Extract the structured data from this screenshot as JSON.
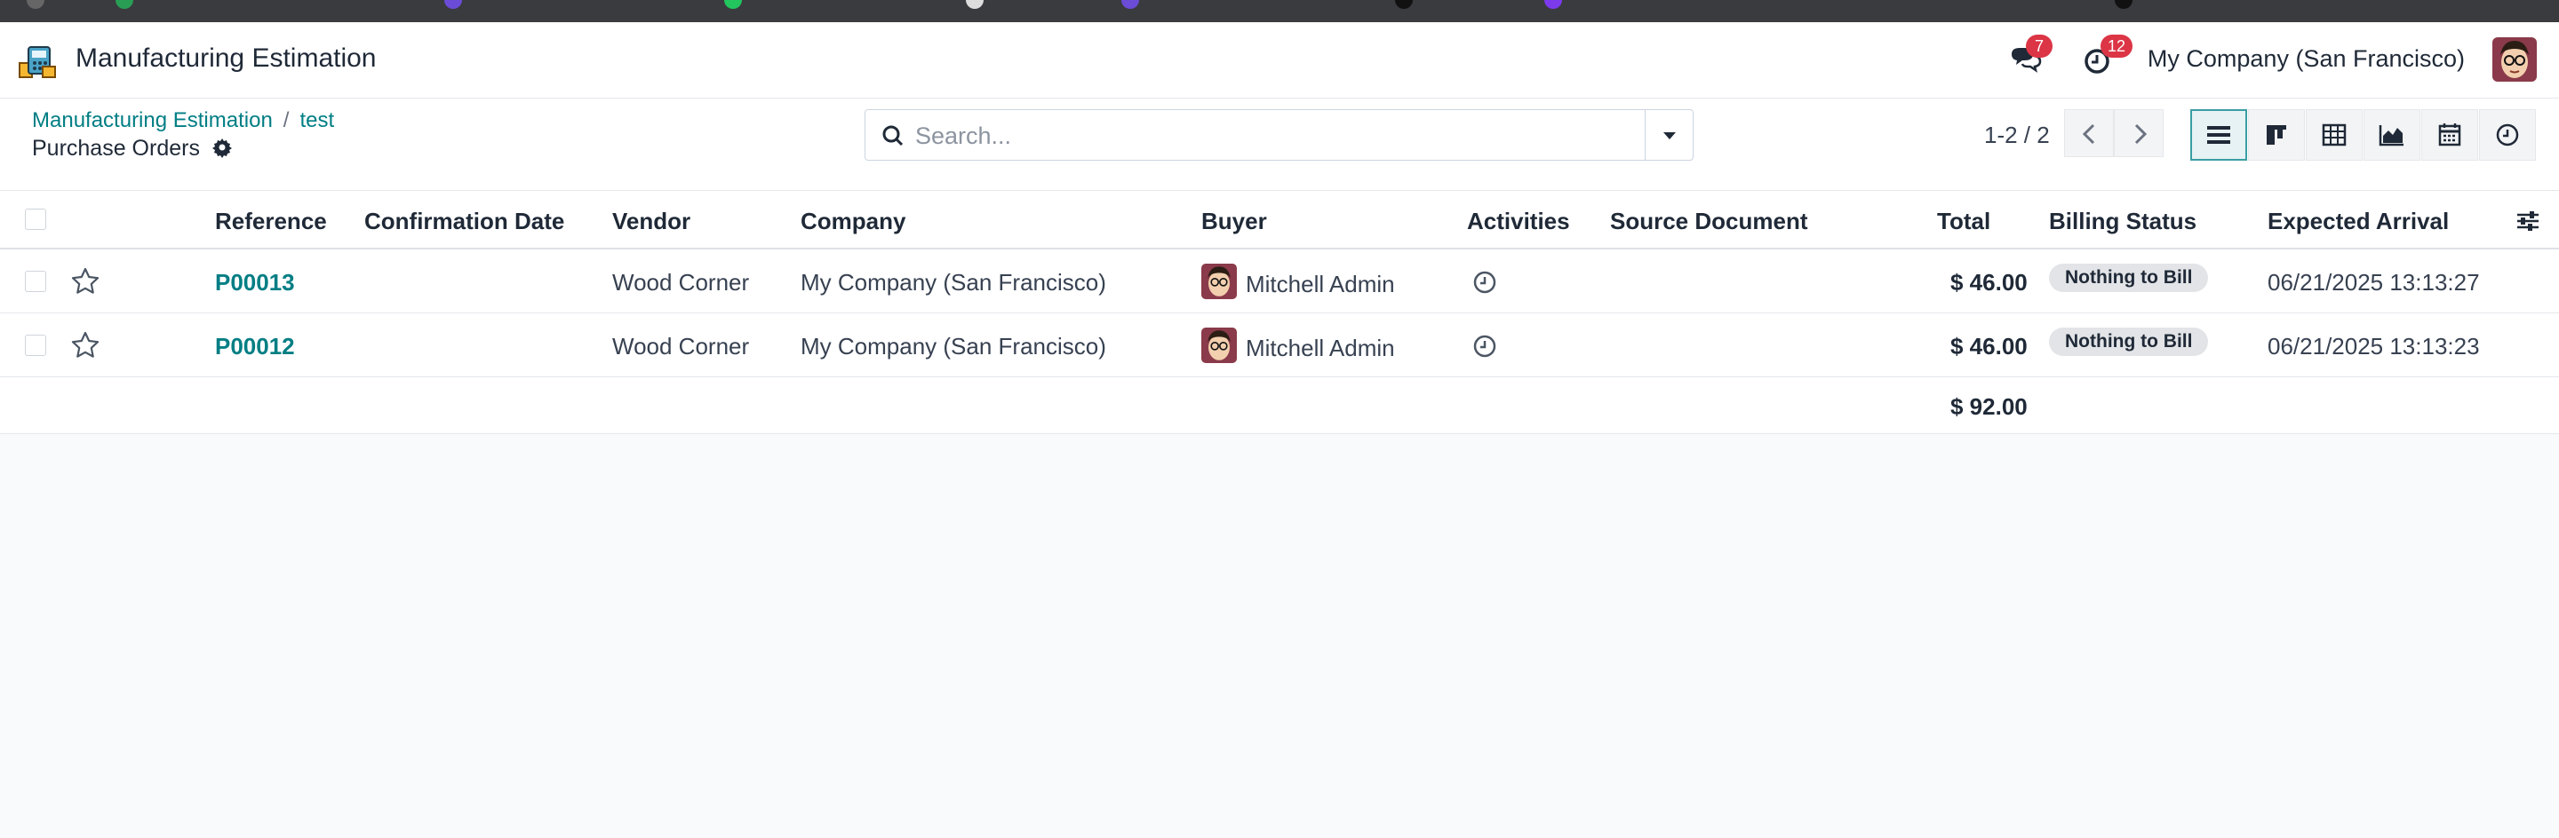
{
  "app": {
    "title": "Manufacturing Estimation"
  },
  "navbar": {
    "messages_count": "7",
    "activities_count": "12",
    "company": "My Company (San Francisco)"
  },
  "breadcrumb": {
    "items": [
      "Manufacturing Estimation",
      "test"
    ],
    "current": "Purchase Orders"
  },
  "search": {
    "placeholder": "Search..."
  },
  "pager": {
    "range": "1-2 / 2"
  },
  "views": [
    "list",
    "kanban",
    "pivot",
    "graph",
    "calendar",
    "activity"
  ],
  "table": {
    "columns": [
      "Reference",
      "Confirmation Date",
      "Vendor",
      "Company",
      "Buyer",
      "Activities",
      "Source Document",
      "Total",
      "Billing Status",
      "Expected Arrival"
    ],
    "rows": [
      {
        "reference": "P00013",
        "confirmation_date": "",
        "vendor": "Wood Corner",
        "company": "My Company (San Francisco)",
        "buyer": "Mitchell Admin",
        "source_document": "",
        "total": "$ 46.00",
        "billing_status": "Nothing to Bill",
        "expected_arrival": "06/21/2025 13:13:27"
      },
      {
        "reference": "P00012",
        "confirmation_date": "",
        "vendor": "Wood Corner",
        "company": "My Company (San Francisco)",
        "buyer": "Mitchell Admin",
        "source_document": "",
        "total": "$ 46.00",
        "billing_status": "Nothing to Bill",
        "expected_arrival": "06/21/2025 13:13:23"
      }
    ],
    "sum_total": "$ 92.00"
  },
  "colors": {
    "accent": "#017e84",
    "badge": "#dc3545",
    "pill": "#e2e4e7"
  }
}
